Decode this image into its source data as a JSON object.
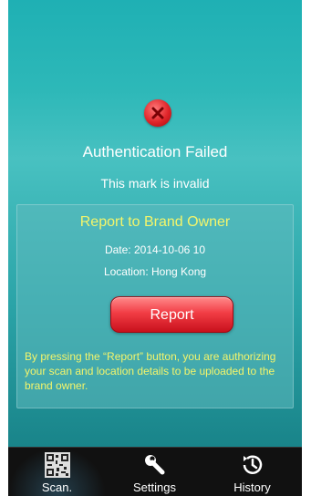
{
  "status": {
    "icon": "error-x-icon",
    "title": "Authentication Failed",
    "subtitle": "This mark is invalid"
  },
  "report_card": {
    "title": "Report to Brand Owner",
    "date": "Date: 2014-10-06 10",
    "location": "Location: Hong Kong",
    "button_label": "Report",
    "note": "By pressing the “Report” button, you are authorizing your scan and location details to be uploaded to the brand owner."
  },
  "tabbar": {
    "items": [
      {
        "label": "Scan.",
        "icon": "qr-code-icon"
      },
      {
        "label": "Settings",
        "icon": "wrench-icon"
      },
      {
        "label": "History",
        "icon": "history-clock-icon"
      }
    ]
  },
  "colors": {
    "accent_yellow": "#f3f56b",
    "error_red": "#e0252a",
    "background_teal": "#2db8b8"
  }
}
